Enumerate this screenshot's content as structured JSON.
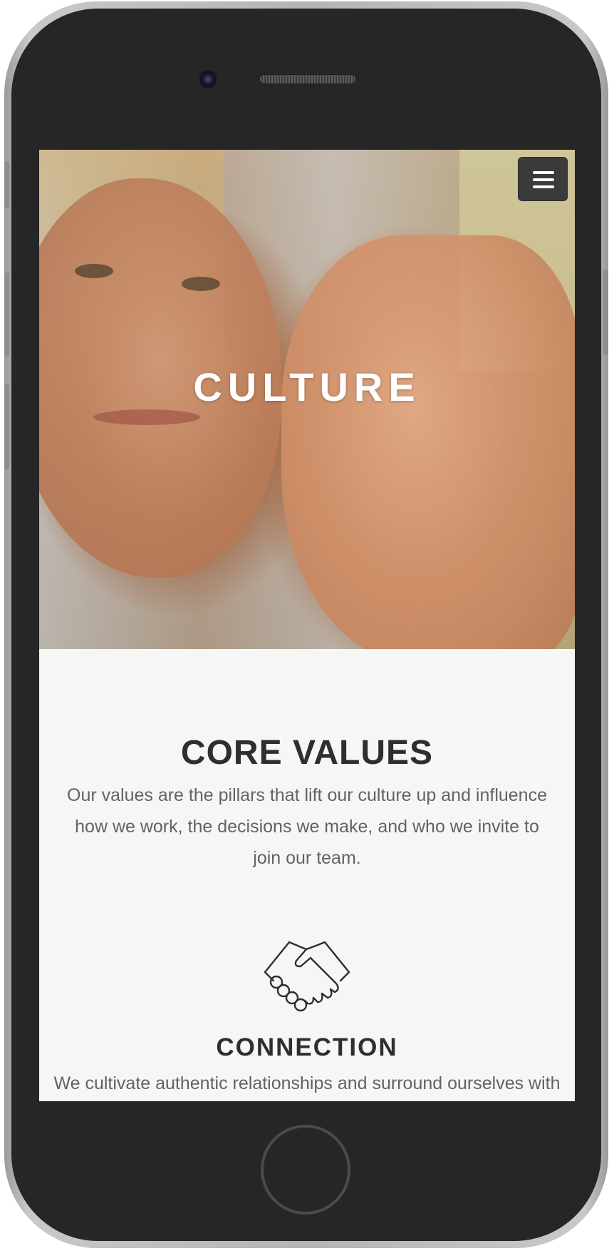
{
  "hero": {
    "title": "CULTURE"
  },
  "nav": {
    "menu_icon": "hamburger-menu-icon"
  },
  "core_values": {
    "title": "CORE VALUES",
    "description": "Our values are the pillars that lift our culture up and influence how we work, the decisions we make, and who we invite to join our team."
  },
  "values": [
    {
      "icon": "handshake-icon",
      "title": "CONNECTION",
      "description": "We cultivate authentic relationships and surround ourselves with inspiring people."
    }
  ],
  "device": {
    "frame_color": "#262626",
    "bezel_color": "#b4b4b8"
  },
  "colors": {
    "heading": "#2e2e2e",
    "body_text": "#636363",
    "background": "#f6f6f5",
    "menu_button": "#3b3b3b"
  }
}
